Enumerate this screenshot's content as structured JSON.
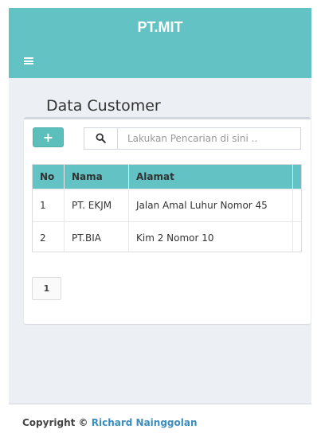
{
  "header": {
    "brand": "PT.MIT",
    "menu_icon": "hamburger-menu-icon"
  },
  "main": {
    "title": "Data Customer",
    "add_button_label": "+",
    "search": {
      "icon": "search-icon",
      "placeholder": "Lakukan Pencarian di sini ..",
      "value": ""
    },
    "table": {
      "columns": [
        "No",
        "Nama",
        "Alamat"
      ],
      "rows": [
        {
          "no": "1",
          "nama": "PT. EKJM",
          "alamat": "Jalan Amal Luhur Nomor 45"
        },
        {
          "no": "2",
          "nama": "PT.BIA",
          "alamat": "Kim 2 Nomor 10"
        }
      ]
    },
    "pagination": {
      "current_page": "1"
    }
  },
  "footer": {
    "copyright_prefix": "Copyright ©",
    "author": "Richard Nainggolan"
  },
  "colors": {
    "header_bg": "#63c2c3",
    "content_bg": "#ecf0f5",
    "link": "#3c8dbc"
  }
}
